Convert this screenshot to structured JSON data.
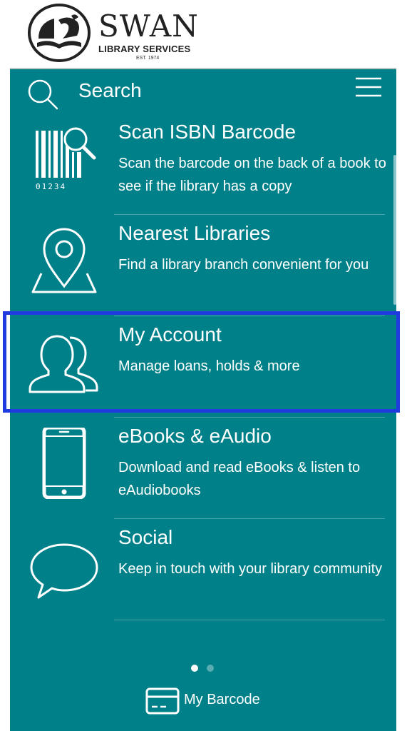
{
  "header": {
    "logo_title": "SWAN",
    "logo_subtitle": "LIBRARY SERVICES",
    "logo_est": "EST. 1974"
  },
  "search": {
    "label": "Search",
    "icon": "search-icon"
  },
  "menu": {
    "icon": "hamburger-menu-icon"
  },
  "items": [
    {
      "title": "Scan ISBN Barcode",
      "desc": "Scan the barcode on the back of a book to see if the library has a copy",
      "icon": "barcode-scan-icon",
      "icon_text": "01234"
    },
    {
      "title": "Nearest Libraries",
      "desc": "Find a library branch convenient for you",
      "icon": "map-pin-icon"
    },
    {
      "title": "My Account",
      "desc": "Manage loans, holds & more",
      "icon": "users-icon"
    },
    {
      "title": "eBooks & eAudio",
      "desc": "Download and read eBooks & listen to eAudiobooks",
      "icon": "tablet-icon"
    },
    {
      "title": "Social",
      "desc": "Keep in touch with your library community",
      "icon": "speech-bubble-icon"
    }
  ],
  "pagination": {
    "current": 1,
    "total": 2
  },
  "footer": {
    "barcode_label": "My Barcode",
    "barcode_icon": "card-icon"
  },
  "colors": {
    "teal": "#008089",
    "highlight": "#1f3be0"
  }
}
